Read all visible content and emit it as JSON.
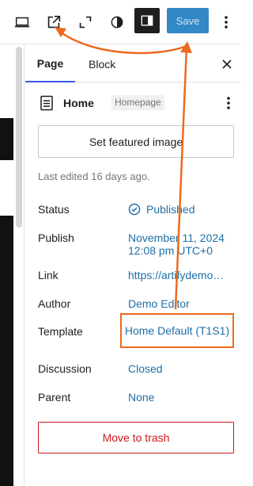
{
  "toolbar": {
    "save_label": "Save",
    "icons": {
      "desktop": "desktop-icon",
      "external": "external-link-icon",
      "fullscreen": "fullscreen-icon",
      "contrast": "contrast-icon",
      "sidebar": "sidebar-toggle-icon",
      "more": "more-vertical-icon"
    }
  },
  "sidebar": {
    "tabs": [
      {
        "label": "Page",
        "active": true
      },
      {
        "label": "Block",
        "active": false
      }
    ],
    "document": {
      "title": "Home",
      "badge": "Homepage"
    },
    "featured_image_button": "Set featured image",
    "last_edited": "Last edited 16 days ago.",
    "rows": {
      "status": {
        "label": "Status",
        "value": "Published"
      },
      "publish": {
        "label": "Publish",
        "value_line1": "November 11, 2024",
        "value_line2": "12:08 pm UTC+0"
      },
      "link": {
        "label": "Link",
        "value": "https://artifydemo…"
      },
      "author": {
        "label": "Author",
        "value": "Demo Editor"
      },
      "template": {
        "label": "Template",
        "value": "Home Default (T1S1)"
      },
      "discussion": {
        "label": "Discussion",
        "value": "Closed"
      },
      "parent": {
        "label": "Parent",
        "value": "None"
      }
    },
    "trash_button": "Move to trash"
  },
  "colors": {
    "accent": "#3858e9",
    "link": "#1e6fa8",
    "save_bg": "#3388c7",
    "danger": "#cc1818",
    "annotation": "#ec6a1e"
  }
}
